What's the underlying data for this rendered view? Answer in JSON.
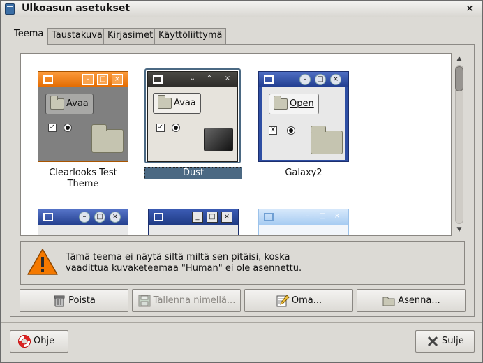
{
  "window": {
    "title": "Ulkoasun asetukset",
    "close_glyph": "×"
  },
  "tabs": [
    {
      "label": "Teema"
    },
    {
      "label": "Taustakuva"
    },
    {
      "label": "Kirjasimet"
    },
    {
      "label": "Käyttöliittymä"
    }
  ],
  "themes": [
    {
      "name": "Clearlooks Test Theme",
      "line1": "Clearlooks Test",
      "line2": "Theme",
      "button_label": "Avaa",
      "selected": false
    },
    {
      "name": "Dust",
      "line1": "Dust",
      "button_label": "Avaa",
      "selected": true
    },
    {
      "name": "Galaxy2",
      "line1": "Galaxy2",
      "button_label": "Open",
      "selected": false
    }
  ],
  "warning": {
    "line1": "Tämä teema ei näytä siltä miltä sen pitäisi, koska",
    "line2": "vaadittua kuvaketeemaa \"Human\" ei ole asennettu."
  },
  "actions": {
    "delete": "Poista",
    "save_as": "Tallenna nimellä...",
    "custom": "Oma...",
    "install": "Asenna..."
  },
  "footer": {
    "help": "Ohje",
    "close": "Sulje"
  },
  "colors": {
    "accent": "#4b6983",
    "clearlooks_titlebar": "#f57900",
    "dust_titlebar": "#3b3a36",
    "galaxy_titlebar": "#2e4ea3",
    "warning": "#f57900"
  }
}
